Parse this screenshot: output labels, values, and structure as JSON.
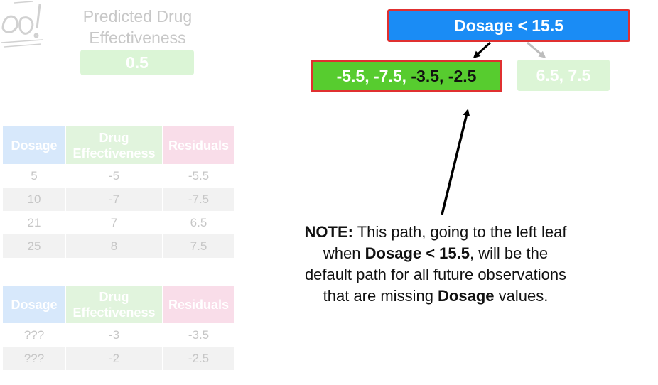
{
  "predicted": {
    "title_line1": "Predicted Drug",
    "title_line2": "Effectiveness",
    "value": "0.5"
  },
  "table1": {
    "headers": [
      "Dosage",
      "Drug Effectiveness",
      "Residuals"
    ],
    "rows": [
      [
        "5",
        "-5",
        "-5.5"
      ],
      [
        "10",
        "-7",
        "-7.5"
      ],
      [
        "21",
        "7",
        "6.5"
      ],
      [
        "25",
        "8",
        "7.5"
      ]
    ]
  },
  "table2": {
    "headers": [
      "Dosage",
      "Drug Effectiveness",
      "Residuals"
    ],
    "rows": [
      [
        "???",
        "-3",
        "-3.5"
      ],
      [
        "???",
        "-2",
        "-2.5"
      ]
    ]
  },
  "tree": {
    "root": "Dosage < 15.5",
    "left_leaf_prefix": "-5.5, -7.5, ",
    "left_leaf_dark": "-3.5, -2.5",
    "right_leaf": "6.5, 7.5"
  },
  "note": {
    "bold1": "NOTE:",
    "text1": " This path, going to the left leaf",
    "text2": "when ",
    "bold2": "Dosage < 15.5",
    "text3": ", will be the",
    "text4": "default path for all future observations",
    "text5": "that are missing ",
    "bold3": "Dosage",
    "text6": " values."
  },
  "colors": {
    "root_fill": "#1a8cf5",
    "left_leaf_fill": "#57cc2f",
    "highlight_border": "#e03030",
    "faded_leaf": "#dcf5d6"
  }
}
